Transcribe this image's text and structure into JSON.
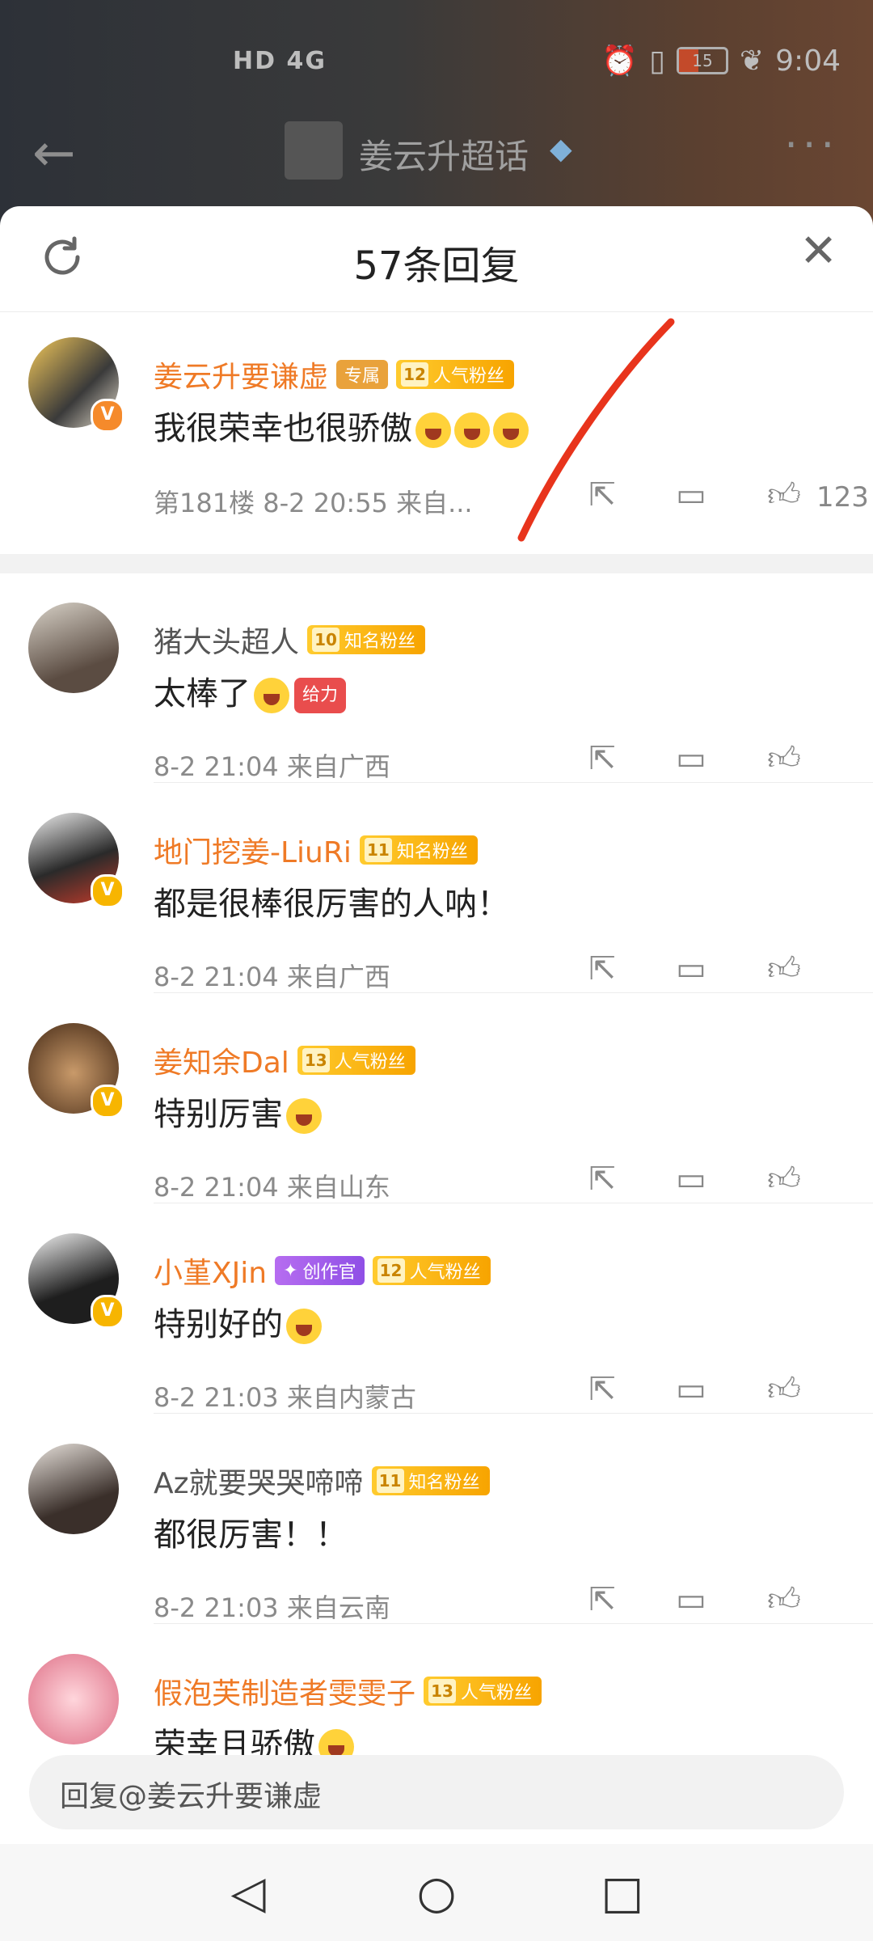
{
  "status_bar": {
    "left": "HD 4G",
    "time": "9:04",
    "battery": "15"
  },
  "topbar": {
    "title": "姜云升超话"
  },
  "sheet": {
    "title": "57条回复"
  },
  "main_comment": {
    "username": "姜云升要谦虚",
    "badge_exclusive": "专属",
    "fan_level": "12",
    "fan_label": "人气粉丝",
    "text": "我很荣幸也很骄傲",
    "meta": "第181楼  8-2 20:55  来自...",
    "like_count": "123"
  },
  "replies": [
    {
      "username": "猪大头超人",
      "fan_level": "10",
      "fan_label": "知名粉丝",
      "text": "太棒了",
      "sticker": "给力",
      "meta": "8-2 21:04  来自广西"
    },
    {
      "username": "地门挖姜-LiuRi",
      "fan_level": "11",
      "fan_label": "知名粉丝",
      "text": "都是很棒很厉害的人呐！",
      "meta": "8-2 21:04  来自广西"
    },
    {
      "username": "姜知余Dal",
      "fan_level": "13",
      "fan_label": "人气粉丝",
      "text": "特别厉害",
      "meta": "8-2 21:04  来自山东"
    },
    {
      "username": "小堇XJin",
      "creator": "创作官",
      "fan_level": "12",
      "fan_label": "人气粉丝",
      "text": "特别好的",
      "meta": "8-2 21:03  来自内蒙古"
    },
    {
      "username": "Az就要哭哭啼啼",
      "fan_level": "11",
      "fan_label": "知名粉丝",
      "text": "都很厉害！！",
      "meta": "8-2 21:03  来自云南"
    },
    {
      "username": "假泡芙制造者雯雯子",
      "fan_level": "13",
      "fan_label": "人气粉丝",
      "text": "荣幸且骄傲"
    }
  ],
  "reply_bar": {
    "placeholder": "回复@姜云升要谦虚"
  },
  "colors": {
    "username_accent": "#ef7a26",
    "annotation_red": "#e8341c",
    "badge_gold": "#f7a400"
  }
}
